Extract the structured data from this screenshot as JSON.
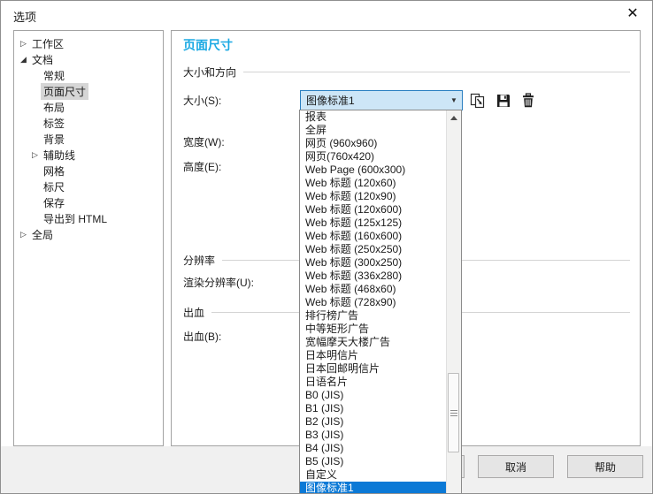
{
  "window": {
    "title": "选项",
    "close_glyph": "✕"
  },
  "colors": {
    "accent_heading": "#1ba9e3",
    "selection_blue": "#0b79d6",
    "combobox_focus_bg": "#cde6f7",
    "combobox_focus_border": "#2a7fc1",
    "tree_selection_bg": "#d6d6d6",
    "footer_bg": "#f0f0f0",
    "button_bg": "#e5e5e5"
  },
  "sidebar": {
    "items": [
      {
        "label": "工作区",
        "level": 0,
        "expander": "collapsed",
        "selected": false
      },
      {
        "label": "文档",
        "level": 0,
        "expander": "expanded",
        "selected": false
      },
      {
        "label": "常规",
        "level": 1,
        "expander": "none",
        "selected": false
      },
      {
        "label": "页面尺寸",
        "level": 1,
        "expander": "none",
        "selected": true
      },
      {
        "label": "布局",
        "level": 1,
        "expander": "none",
        "selected": false
      },
      {
        "label": "标签",
        "level": 1,
        "expander": "none",
        "selected": false
      },
      {
        "label": "背景",
        "level": 1,
        "expander": "none",
        "selected": false
      },
      {
        "label": "辅助线",
        "level": 1,
        "expander": "collapsed",
        "selected": false
      },
      {
        "label": "网格",
        "level": 1,
        "expander": "none",
        "selected": false
      },
      {
        "label": "标尺",
        "level": 1,
        "expander": "none",
        "selected": false
      },
      {
        "label": "保存",
        "level": 1,
        "expander": "none",
        "selected": false
      },
      {
        "label": "导出到 HTML",
        "level": 1,
        "expander": "none",
        "selected": false
      },
      {
        "label": "全局",
        "level": 0,
        "expander": "collapsed",
        "selected": false
      }
    ]
  },
  "main": {
    "panel_title": "页面尺寸",
    "group_size_orientation": "大小和方向",
    "group_resolution": "分辨率",
    "group_bleed": "出血",
    "label_size": "大小(S):",
    "label_width": "宽度(W):",
    "label_height": "高度(E):",
    "label_render_resolution": "渲染分辨率(U):",
    "label_bleed": "出血(B):",
    "combobox_value": "图像标准1",
    "combobox_arrow": "▼",
    "toolbar_icons": [
      "get-page-size-from-printer",
      "save-page-size",
      "delete-page-size"
    ]
  },
  "dropdown": {
    "selected_item": "图像标准1",
    "items": [
      "报表",
      "全屏",
      "网页 (960x960)",
      "网页(760x420)",
      "Web Page (600x300)",
      "Web 标题 (120x60)",
      "Web 标题 (120x90)",
      "Web 标题 (120x600)",
      "Web 标题 (125x125)",
      "Web 标题 (160x600)",
      "Web 标题 (250x250)",
      "Web 标题 (300x250)",
      "Web 标题 (336x280)",
      "Web 标题 (468x60)",
      "Web 标题 (728x90)",
      "排行榜广告",
      "中等矩形广告",
      "宽幅摩天大楼广告",
      "日本明信片",
      "日本回邮明信片",
      "日语名片",
      "B0 (JIS)",
      "B1 (JIS)",
      "B2 (JIS)",
      "B3 (JIS)",
      "B4 (JIS)",
      "B5 (JIS)",
      "自定义",
      "图像标准1"
    ]
  },
  "footer": {
    "cancel_label": "取消",
    "help_label": "帮助"
  }
}
